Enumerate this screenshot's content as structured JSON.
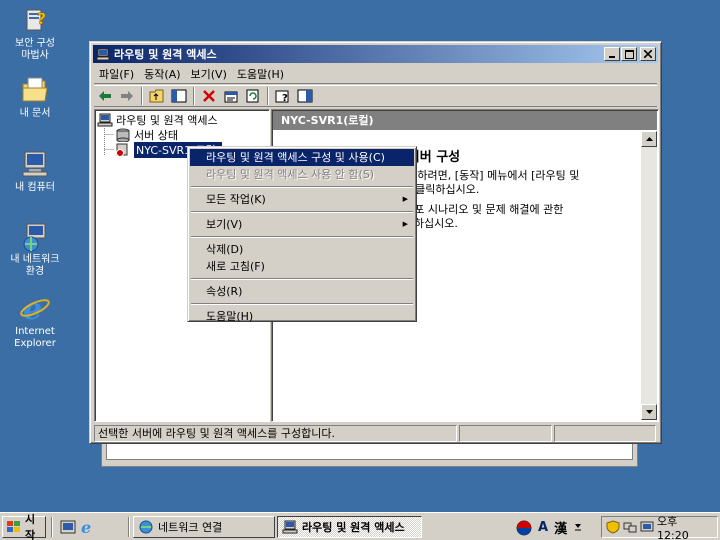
{
  "desktop": {
    "icons": [
      {
        "label": "보안 구성\n마법사",
        "icon": "security-wizard-icon"
      },
      {
        "label": "내 문서",
        "icon": "my-documents-icon"
      },
      {
        "label": "내 컴퓨터",
        "icon": "my-computer-icon"
      },
      {
        "label": "내 네트워크\n환경",
        "icon": "network-places-icon"
      },
      {
        "label": "Internet\nExplorer",
        "icon": "internet-explorer-icon"
      }
    ]
  },
  "window": {
    "title": "라우팅 및 원격 액세스",
    "menu": [
      "파일(F)",
      "동작(A)",
      "보기(V)",
      "도움말(H)"
    ],
    "tree": {
      "root": "라우팅 및 원격 액세스",
      "server_status": "서버 상태",
      "server": "NYC-SVR1(로컬)"
    },
    "detail": {
      "header": "NYC-SVR1(로컬)",
      "title": "라우팅 및 원격 액세스 서버 구성",
      "paragraph1": "라우팅 및 원격 액세스를 설치하려면, [동작] 메뉴에서 [라우팅 및 원격 액세스 구성 및 사용]을 클릭하십시오.",
      "paragraph2": "서버 구성, 네트워크 설치, 배포 시나리오 및 문제 해결에 관한 자세한 내용은 도움말을 참조하십시오.",
      "paragraph1_visible": "라우팅 및 원격 액세스를 설치하려면, [동작] 메뉴에서 [라우팅 및",
      "paragraph1_visible_b": "원격 액세스 구성 및 사용]을 클릭하십시오.",
      "paragraph2_visible": "서버 구성, 네트워크 설치, 배포 시나리오 및 문제 해결에 관한",
      "paragraph2_visible_b": "자세한 내용은 도움말을 참조하십시오."
    },
    "status": "선택한 서버에 라우팅 및 원격 액세스를 구성합니다."
  },
  "context_menu": {
    "configure": "라우팅 및 원격 액세스 구성 및 사용(C)",
    "disable": "라우팅 및 원격 액세스 사용 안 함(S)",
    "all_tasks": "모든 작업(K)",
    "view": "보기(V)",
    "delete": "삭제(D)",
    "refresh": "새로 고침(F)",
    "properties": "속성(R)",
    "help": "도움말(H)"
  },
  "taskbar": {
    "start": "시작",
    "tasks": [
      "네트워크 연결",
      "라우팅 및 원격 액세스"
    ],
    "lang_a": "A",
    "lang_han": "漢",
    "clock": "오후 12:20"
  },
  "colors": {
    "desktop": "#3a6ea5",
    "title_active": "#0a246a",
    "face": "#d4d0c8"
  }
}
